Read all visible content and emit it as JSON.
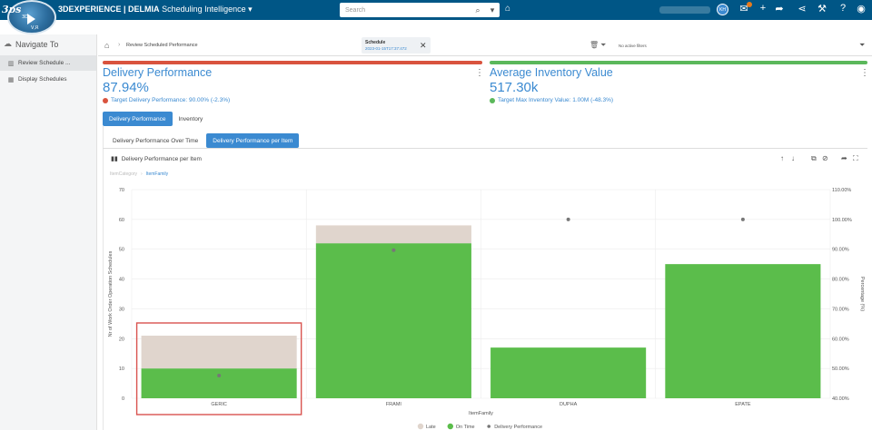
{
  "topbar": {
    "brand_bold": "3DEXPERIENCE | DELMIA",
    "brand_app": "Scheduling Intelligence",
    "search_placeholder": "Search",
    "avatar_initials": "KH",
    "compass_labels": [
      "3D",
      "V,R"
    ]
  },
  "sidebar": {
    "title": "Navigate To",
    "items": [
      {
        "label": "Review Schedule ...",
        "active": true
      },
      {
        "label": "Display Schedules",
        "active": false
      }
    ]
  },
  "breadcrumb": {
    "current": "Review Scheduled Performance",
    "schedule_label": "Schedule",
    "schedule_value": "2023-01-15T17:37:472",
    "no_filters": "No active filters"
  },
  "kpis": [
    {
      "title": "Delivery Performance",
      "value": "87.94%",
      "target": "Target Delivery Performance: 90.00% (-2.3%)",
      "bar_color": "#d9533e",
      "dot_color": "#d9533e"
    },
    {
      "title": "Average Inventory Value",
      "value": "517.30k",
      "target": "Target Max Inventory Value: 1.00M (-48.3%)",
      "bar_color": "#5bb85b",
      "dot_color": "#5bb85b"
    }
  ],
  "tabs_main": [
    {
      "label": "Delivery Performance",
      "active": true
    },
    {
      "label": "Inventory",
      "active": false
    }
  ],
  "tabs_sub": [
    {
      "label": "Delivery Performance Over Time",
      "active": false
    },
    {
      "label": "Delivery Performance per Item",
      "active": true
    }
  ],
  "chart_header": {
    "title": "Delivery Performance per Item",
    "crumb_a": "ItemCategory",
    "crumb_b": "ItemFamily"
  },
  "chart_data": {
    "type": "bar",
    "categories": [
      "GERIC",
      "FRAMI",
      "DUPHA",
      "EPATE"
    ],
    "series": [
      {
        "name": "On Time",
        "values": [
          10,
          52,
          17,
          45
        ],
        "color": "#5bbd4b"
      },
      {
        "name": "Late",
        "values": [
          11,
          6,
          0,
          0
        ],
        "color": "#e0d5cd"
      },
      {
        "name": "Delivery Performance",
        "values": [
          47.6,
          89.7,
          100,
          100
        ],
        "color": "#777777",
        "axis": "right"
      }
    ],
    "xlabel": "ItemFamily",
    "ylabel": "Nr of Work Order Operation Schedules",
    "y2label": "Percentage (%)",
    "ylim": [
      0,
      70
    ],
    "y_ticks": [
      0,
      10,
      20,
      30,
      40,
      50,
      60,
      70
    ],
    "y2lim": [
      40,
      110
    ],
    "y2_ticks": [
      "40.00%",
      "50.00%",
      "60.00%",
      "70.00%",
      "80.00%",
      "90.00%",
      "100.00%",
      "110.00%"
    ],
    "legend": [
      "Late",
      "On Time",
      "Delivery Performance"
    ],
    "legend_position": "bottom",
    "highlight_category": "GERIC",
    "highlight_color": "#d9534f",
    "grid": true
  }
}
